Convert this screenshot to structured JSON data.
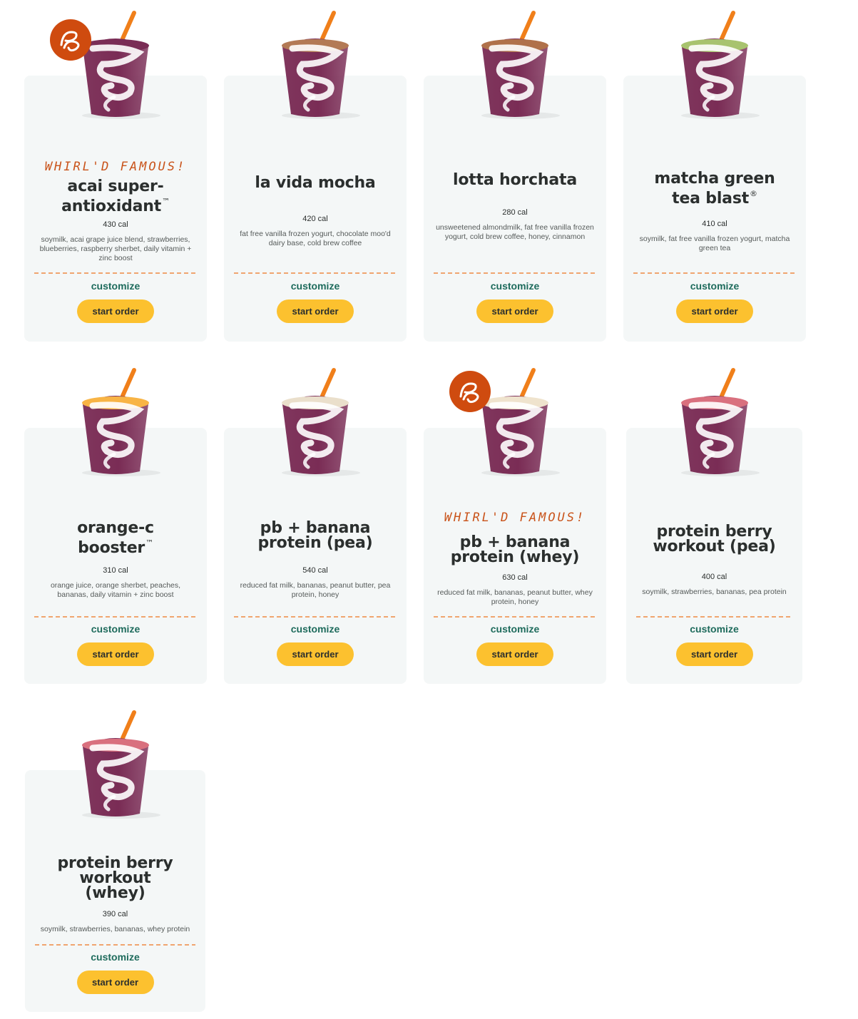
{
  "famous_label": "WHIRL'D FAMOUS!",
  "customize_label": "customize",
  "start_order_label": "start order",
  "colors": {
    "card_bg": "#f4f7f7",
    "button": "#fcc12f",
    "customize_text": "#1e6b5c",
    "badge": "#cf4b0f",
    "divider": "#f0a56f"
  },
  "products": [
    {
      "name_lines": [
        "acai super-",
        "antioxidant"
      ],
      "mark": "™",
      "calories": "430 cal",
      "ingredients": "soymilk, acai grape juice blend, strawberries, blueberries, raspberry sherbet, daily vitamin + zinc boost",
      "whirld_famous": true,
      "smoothie_color": "#7a2c55"
    },
    {
      "name_lines": [
        "la vida mocha"
      ],
      "mark": "",
      "calories": "420 cal",
      "ingredients": "fat free vanilla frozen yogurt, chocolate moo'd dairy base, cold brew coffee",
      "whirld_famous": false,
      "smoothie_color": "#b37a55"
    },
    {
      "name_lines": [
        "lotta horchata"
      ],
      "mark": "",
      "calories": "280 cal",
      "ingredients": "unsweetened almondmilk, fat free vanilla frozen yogurt, cold brew coffee, honey, cinnamon",
      "whirld_famous": false,
      "smoothie_color": "#b0714a"
    },
    {
      "name_lines": [
        "matcha green",
        "tea blast"
      ],
      "mark": "®",
      "calories": "410 cal",
      "ingredients": "soymilk, fat free vanilla frozen yogurt, matcha green tea",
      "whirld_famous": false,
      "smoothie_color": "#a8c36e"
    },
    {
      "name_lines": [
        "orange-c",
        "booster"
      ],
      "mark": "™",
      "calories": "310 cal",
      "ingredients": "orange juice, orange sherbet, peaches, bananas, daily vitamin + zinc boost",
      "whirld_famous": false,
      "smoothie_color": "#f8b445"
    },
    {
      "name_lines": [
        "pb + banana",
        "protein (pea)"
      ],
      "mark": "",
      "calories": "540 cal",
      "ingredients": "reduced fat milk, bananas, peanut butter, pea protein, honey",
      "whirld_famous": false,
      "smoothie_color": "#eadfcb"
    },
    {
      "name_lines": [
        "pb + banana",
        "protein (whey)"
      ],
      "mark": "",
      "calories": "630 cal",
      "ingredients": "reduced fat milk, bananas, peanut butter, whey protein, honey",
      "whirld_famous": true,
      "smoothie_color": "#efe3cd"
    },
    {
      "name_lines": [
        "protein berry",
        "workout (pea)"
      ],
      "mark": "",
      "calories": "400 cal",
      "ingredients": "soymilk, strawberries, bananas, pea protein",
      "whirld_famous": false,
      "smoothie_color": "#d9707e"
    },
    {
      "name_lines": [
        "protein berry",
        "workout",
        "(whey)"
      ],
      "mark": "",
      "calories": "390 cal",
      "ingredients": "soymilk, strawberries, bananas, whey protein",
      "whirld_famous": false,
      "smoothie_color": "#d9707e"
    }
  ]
}
